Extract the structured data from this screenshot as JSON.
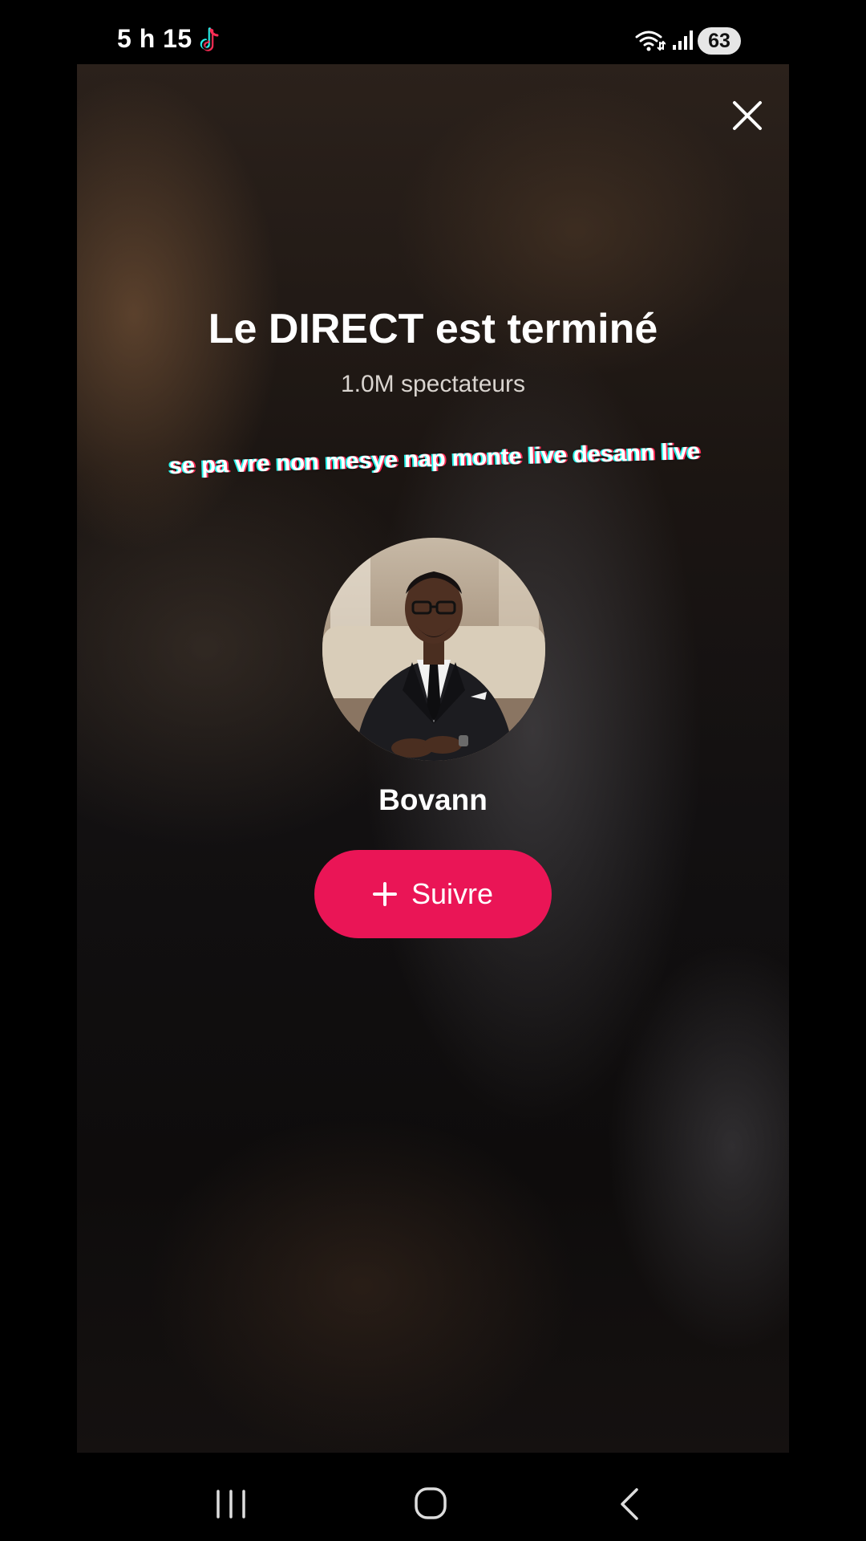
{
  "status_bar": {
    "time": "5 h 15",
    "battery": "63",
    "icons": [
      "tiktok-icon",
      "wifi-icon",
      "signal-icon",
      "battery-icon"
    ]
  },
  "live_ended": {
    "title": "Le DIRECT est terminé",
    "viewers": "1.0M spectateurs",
    "caption": "se pa vre non mesye nap monte live desann live",
    "host_name": "Bovann",
    "follow_label": "Suivre"
  },
  "colors": {
    "follow_button": "#ea1556",
    "caption_outline_cyan": "#25f4ee",
    "caption_outline_red": "#fe2c55",
    "background": "#000000"
  },
  "navigation": {
    "icons": [
      "recents-icon",
      "home-icon",
      "back-icon"
    ]
  }
}
